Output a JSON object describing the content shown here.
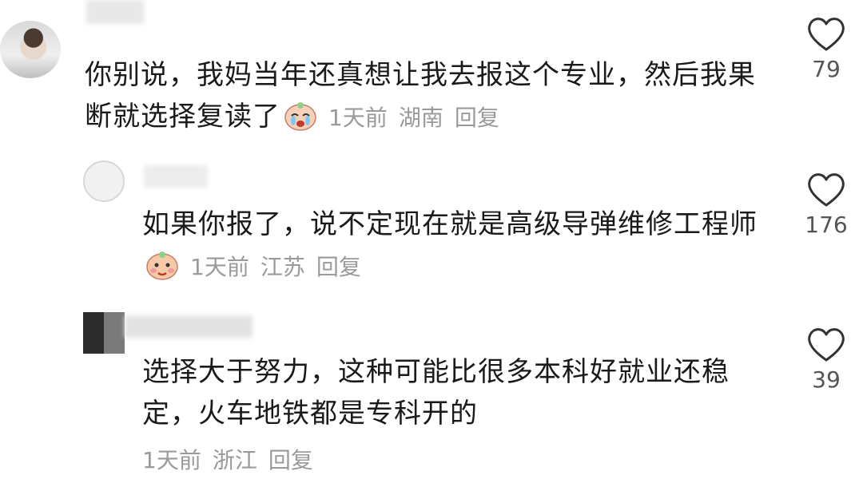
{
  "comments": [
    {
      "text": "你别说，我妈当年还真想让我去报这个专业，然后我果断就选择复读了",
      "emoji": "crying-face-emoji",
      "time": "1天前",
      "location": "湖南",
      "reply_label": "回复",
      "likes": "79"
    },
    {
      "text": "如果你报了，说不定现在就是高级导弹维修工程师",
      "emoji": "smirk-face-emoji",
      "time": "1天前",
      "location": "江苏",
      "reply_label": "回复",
      "likes": "176"
    },
    {
      "text": "选择大于努力，这种可能比很多本科好就业还稳定，火车地铁都是专科开的",
      "time": "1天前",
      "location": "浙江",
      "reply_label": "回复",
      "likes": "39"
    }
  ],
  "colors": {
    "text": "#1a1a1a",
    "meta": "#9a9a9a",
    "like_count": "#555555",
    "heart_outline": "#333333"
  },
  "icons": {
    "like": "heart-outline-icon"
  }
}
